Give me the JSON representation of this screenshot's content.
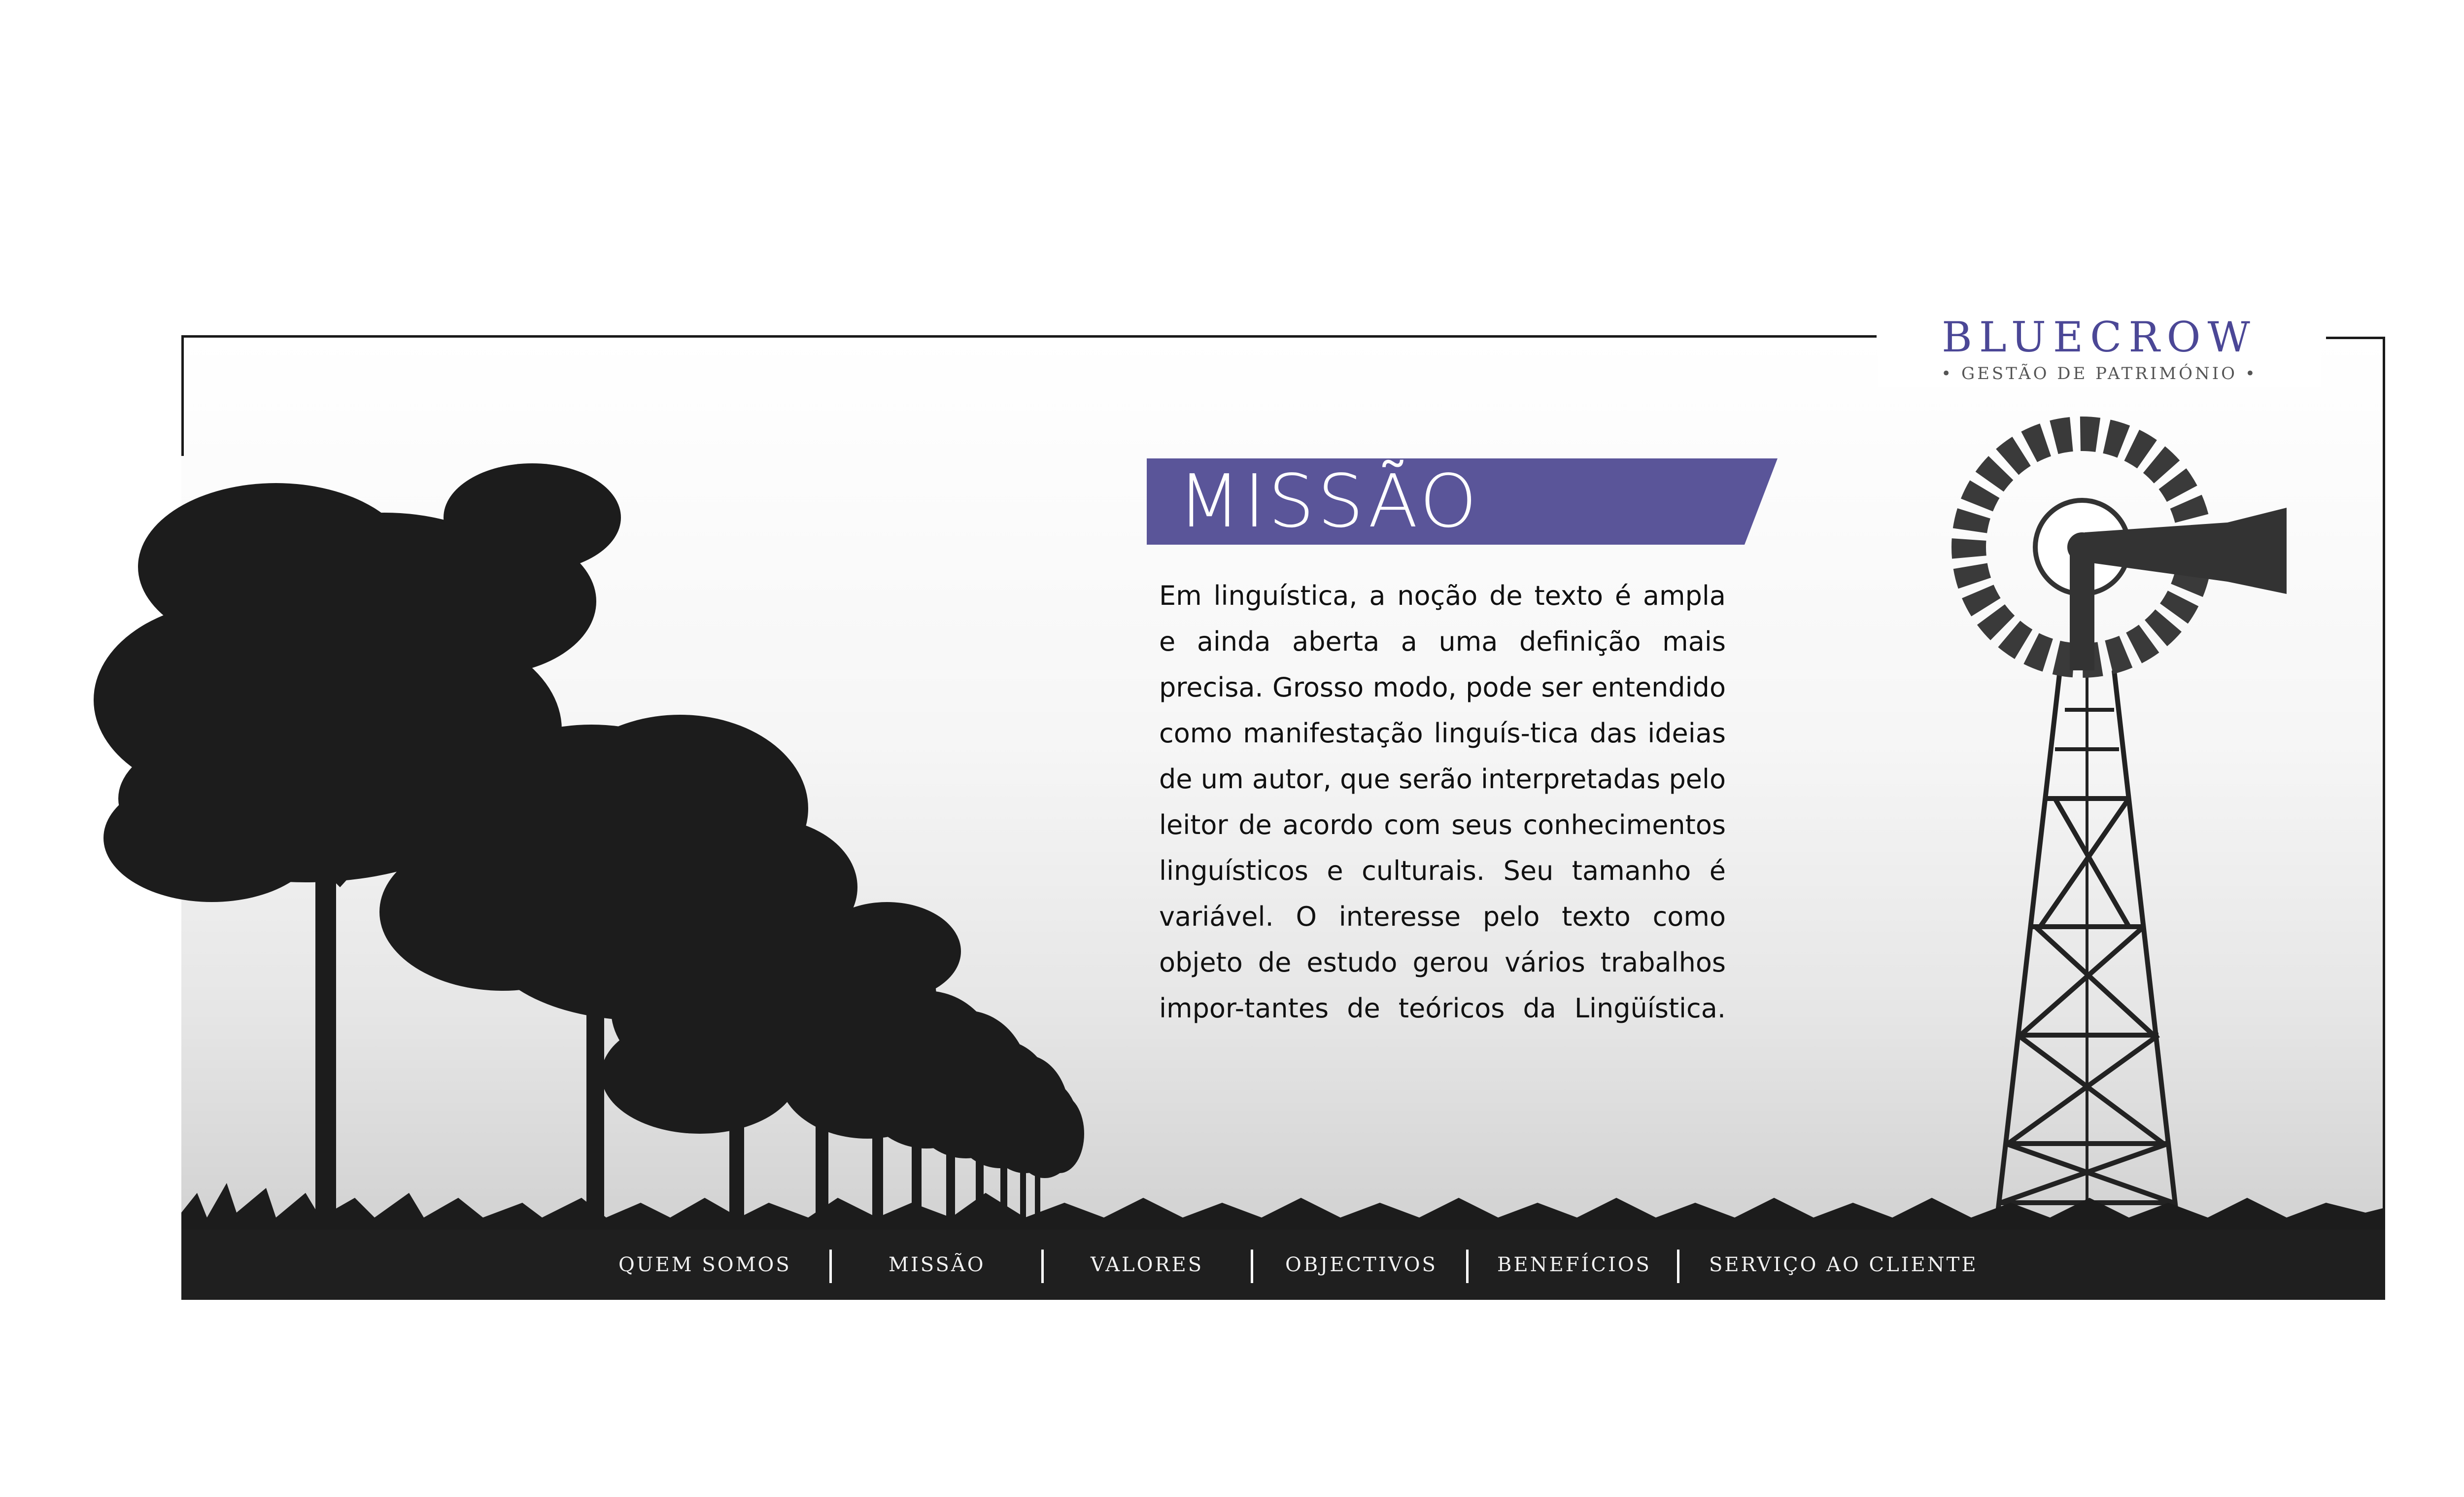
{
  "brand": {
    "name": "BLUECROW",
    "tagline": "• GESTÃO DE PATRIMÓNIO •",
    "accent_color": "#4b4796"
  },
  "section": {
    "title": "MISSÃO",
    "banner_color": "#5a5599",
    "body": "Em linguística, a noção de texto é ampla e ainda aberta a uma definição mais precisa. Grosso modo, pode ser entendido como manifestação linguís-tica das ideias de um autor, que serão interpretadas pelo leitor de acordo com seus conhecimentos linguísticos e culturais. Seu tamanho é variável. O interesse pelo texto como objeto de estudo gerou vários trabalhos impor-tantes de teóricos da Lingüística."
  },
  "nav": {
    "items": [
      {
        "label": "QUEM SOMOS"
      },
      {
        "label": "MISSÃO"
      },
      {
        "label": "VALORES"
      },
      {
        "label": "OBJECTIVOS"
      },
      {
        "label": "BENEFÍCIOS"
      },
      {
        "label": "SERVIÇO AO CLIENTE"
      }
    ]
  },
  "illustration": {
    "left": "trees-silhouette",
    "right": "windmill-silhouette",
    "ground": "grass-silhouette"
  }
}
